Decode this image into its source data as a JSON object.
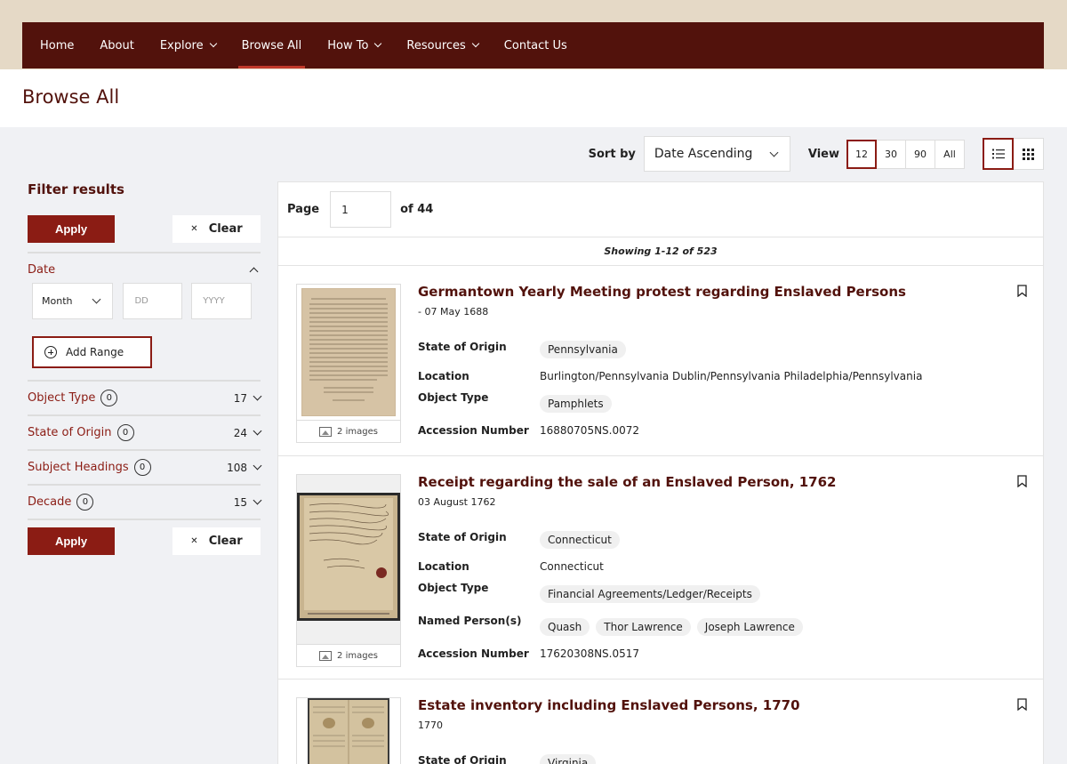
{
  "nav": {
    "items": [
      {
        "label": "Home"
      },
      {
        "label": "About"
      },
      {
        "label": "Explore"
      },
      {
        "label": "Browse All"
      },
      {
        "label": "How To"
      },
      {
        "label": "Resources"
      },
      {
        "label": "Contact Us"
      }
    ],
    "active": "Browse All"
  },
  "page": {
    "title": "Browse All"
  },
  "toolbar": {
    "sort_label": "Sort by",
    "sort_value": "Date Ascending",
    "view_label": "View",
    "view_options": [
      "12",
      "30",
      "90",
      "All"
    ],
    "view_selected": "12",
    "layout_selected": "list"
  },
  "filters": {
    "title": "Filter results",
    "apply_label": "Apply",
    "clear_label": "Clear",
    "date": {
      "label": "Date",
      "month_value": "Month",
      "day_placeholder": "DD",
      "year_placeholder": "YYYY",
      "add_range_label": "Add Range"
    },
    "sections": [
      {
        "label": "Object Type",
        "selected": "0",
        "count": "17"
      },
      {
        "label": "State of Origin",
        "selected": "0",
        "count": "24"
      },
      {
        "label": "Subject Headings",
        "selected": "0",
        "count": "108"
      },
      {
        "label": "Decade",
        "selected": "0",
        "count": "15"
      }
    ]
  },
  "pager": {
    "label": "Page",
    "value": "1",
    "of_text": "of 44",
    "showing": "Showing 1-12 of 523"
  },
  "results": [
    {
      "title": "Germantown Yearly Meeting protest regarding Enslaved Persons",
      "date": "- 07 May 1688",
      "images": "2 images",
      "state_label": "State of Origin",
      "state": "Pennsylvania",
      "location_label": "Location",
      "location": "Burlington/Pennsylvania Dublin/Pennsylvania Philadelphia/Pennsylvania",
      "object_type_label": "Object Type",
      "object_type": "Pamphlets",
      "accession_label": "Accession Number",
      "accession": "16880705NS.0072"
    },
    {
      "title": "Receipt regarding the sale of an Enslaved Person, 1762",
      "date": "03 August 1762",
      "images": "2 images",
      "state_label": "State of Origin",
      "state": "Connecticut",
      "location_label": "Location",
      "location": "Connecticut",
      "object_type_label": "Object Type",
      "object_type": "Financial Agreements/Ledger/Receipts",
      "named_label": "Named Person(s)",
      "named": [
        "Quash",
        "Thor Lawrence",
        "Joseph Lawrence"
      ],
      "accession_label": "Accession Number",
      "accession": "17620308NS.0517"
    },
    {
      "title": "Estate inventory including Enslaved Persons, 1770",
      "date": "1770",
      "state_label": "State of Origin",
      "state": "Virginia"
    }
  ],
  "colors": {
    "nav_bg": "#52120c",
    "accent": "#8b1c14",
    "top_band": "#e5d9c6",
    "page_bg": "#f0f1f4"
  }
}
